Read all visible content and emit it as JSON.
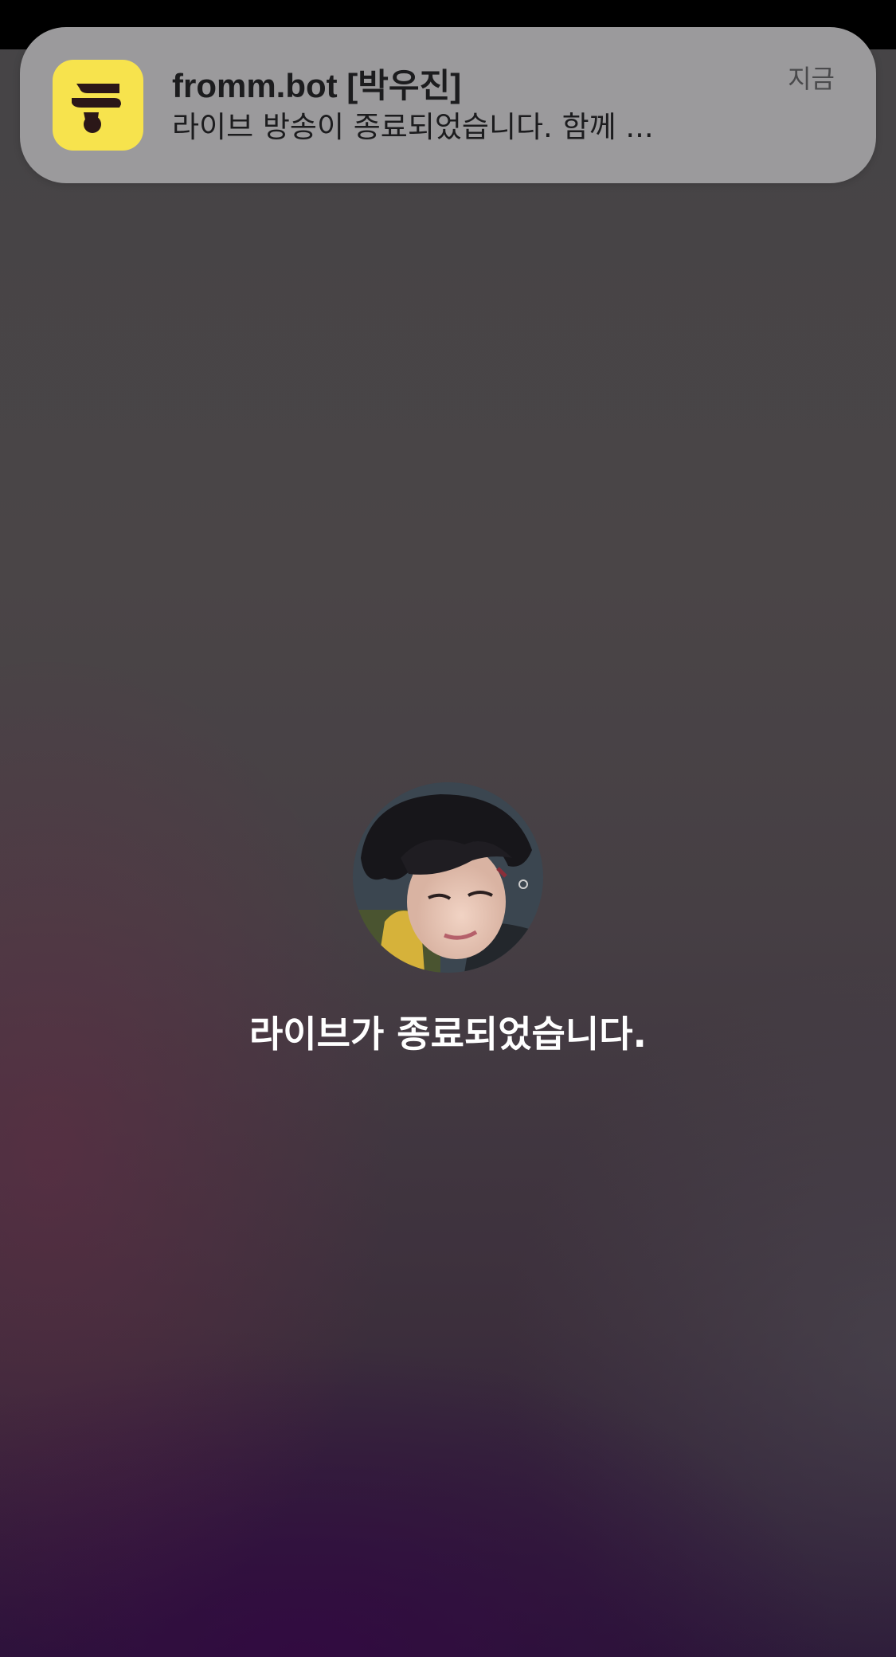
{
  "notification": {
    "app_icon": "fromm-logo-icon",
    "title": "fromm.bot [박우진]",
    "body": "라이브 방송이 종료되었습니다. 함께 ...",
    "time": "지금"
  },
  "live_end": {
    "avatar": "profile-avatar",
    "message": "라이브가 종료되었습니다."
  },
  "colors": {
    "app_icon_bg": "#f7e34d",
    "notification_bg": "#9b9a9c",
    "message_text": "#ffffff"
  }
}
